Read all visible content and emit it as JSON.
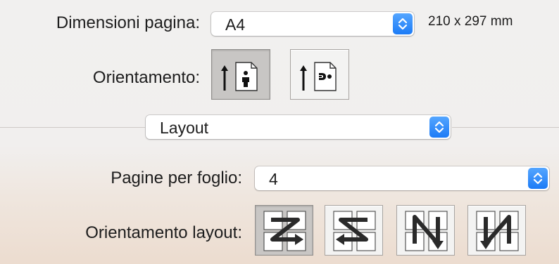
{
  "page_setup": {
    "paper_size_label": "Dimensioni pagina:",
    "paper_size_value": "A4",
    "paper_dimensions": "210 x 297 mm",
    "orientation_label": "Orientamento:",
    "orientation_options": [
      {
        "icon": "portrait-orientation-icon",
        "selected": true
      },
      {
        "icon": "landscape-orientation-icon",
        "selected": false
      }
    ]
  },
  "section_selector": {
    "value": "Layout"
  },
  "layout": {
    "pages_per_sheet_label": "Pagine per foglio:",
    "pages_per_sheet_value": "4",
    "layout_direction_label": "Orientamento layout:",
    "layout_direction_options": [
      {
        "icon": "z-layout-icon",
        "selected": true
      },
      {
        "icon": "reverse-z-layout-icon",
        "selected": false
      },
      {
        "icon": "n-layout-icon",
        "selected": false
      },
      {
        "icon": "reverse-n-layout-icon",
        "selected": false
      }
    ]
  },
  "colors": {
    "accent": "#1c7bf6",
    "selected_tile": "#c8c6c4"
  }
}
